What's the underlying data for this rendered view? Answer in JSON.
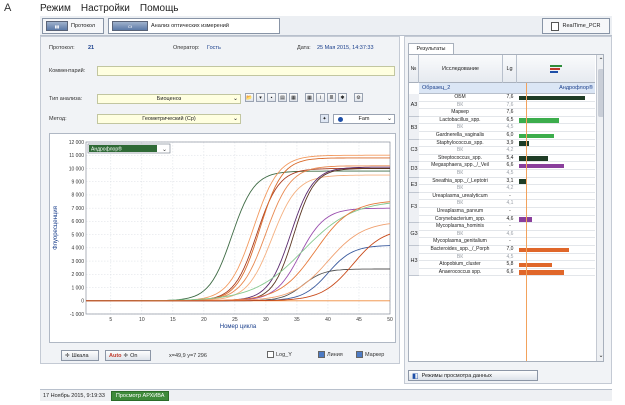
{
  "corner_label": "A",
  "menu": [
    "Режим",
    "Настройки",
    "Помощь"
  ],
  "tabs": {
    "protocol": "Протокол",
    "analysis": "Анализ оптических измерений",
    "realtime": "RealTime_PCR"
  },
  "protocol": {
    "label": "Протокол:",
    "value": "21"
  },
  "operator": {
    "label": "Оператор:",
    "value": "Гость"
  },
  "date": {
    "label": "Дата:",
    "value": "25 Мая 2015, 14:37:33"
  },
  "comment": {
    "label": "Комментарий:",
    "value": ""
  },
  "analysis_type": {
    "label": "Тип анализа:",
    "value": "Биоценоз"
  },
  "method": {
    "label": "Метод:",
    "value": "Геометрический (Cp)"
  },
  "channel": {
    "value": "Fam"
  },
  "results_tab": "Результаты",
  "table": {
    "headers": {
      "num": "№",
      "test": "Исследование",
      "lg": "Lg"
    },
    "sample": {
      "name": "Образец_2",
      "kit": "Андрофлор®"
    },
    "groups": [
      {
        "id": "A3",
        "rows": [
          {
            "name": "ОБМ",
            "lg": "7,6",
            "bar": 0.92,
            "color": "#1f3d26",
            "dim": false
          },
          {
            "name": "ВК",
            "lg": "7,6",
            "bar": 0,
            "color": "",
            "dim": true
          },
          {
            "name": "Маркер",
            "lg": "7,6",
            "bar": 0,
            "color": "",
            "dim": false
          }
        ]
      },
      {
        "id": "B3",
        "rows": [
          {
            "name": "Lactobacillus_spp.",
            "lg": "6,5",
            "bar": 0.55,
            "color": "#3cad4c",
            "dim": false
          },
          {
            "name": "ВК",
            "lg": "4,5",
            "bar": 0,
            "color": "",
            "dim": true
          },
          {
            "name": "Gardnerella_vaginalis",
            "lg": "6,0",
            "bar": 0.48,
            "color": "#3cad4c",
            "dim": false
          }
        ]
      },
      {
        "id": "C3",
        "rows": [
          {
            "name": "Staphylococcus_spp.",
            "lg": "3,9",
            "bar": 0.14,
            "color": "#1f3d26",
            "dim": false
          },
          {
            "name": "ВК",
            "lg": "4,2",
            "bar": 0,
            "color": "",
            "dim": true
          },
          {
            "name": "Streptococcus_spp.",
            "lg": "5,4",
            "bar": 0.4,
            "color": "#1f3d26",
            "dim": false
          }
        ]
      },
      {
        "id": "D3",
        "rows": [
          {
            "name": "Megasphaera_spp._/_Veil",
            "lg": "6,6",
            "bar": 0.62,
            "color": "#8a3f9c",
            "dim": false
          },
          {
            "name": "ВК",
            "lg": "4,5",
            "bar": 0,
            "color": "",
            "dim": true
          }
        ]
      },
      {
        "id": "E3",
        "rows": [
          {
            "name": "Sneathia_spp._/_Leptotri",
            "lg": "3,1",
            "bar": 0.1,
            "color": "#1f3d26",
            "dim": false
          },
          {
            "name": "ВК",
            "lg": "4,2",
            "bar": 0,
            "color": "",
            "dim": true
          }
        ]
      },
      {
        "id": "F3",
        "rows": [
          {
            "name": "Ureaplasma_urealyticum",
            "lg": "-",
            "bar": 0,
            "color": "",
            "dim": false
          },
          {
            "name": "ВК",
            "lg": "4,1",
            "bar": 0,
            "color": "",
            "dim": true
          },
          {
            "name": "Ureaplasma_parvum",
            "lg": "-",
            "bar": 0,
            "color": "",
            "dim": false
          },
          {
            "name": "Corynebacterium_spp.",
            "lg": "4,6",
            "bar": 0.18,
            "color": "#8a3f9c",
            "dim": false
          }
        ]
      },
      {
        "id": "G3",
        "rows": [
          {
            "name": "Mycoplasma_hominis",
            "lg": "-",
            "bar": 0,
            "color": "",
            "dim": false
          },
          {
            "name": "ВК",
            "lg": "4,6",
            "bar": 0,
            "color": "",
            "dim": true
          },
          {
            "name": "Mycoplasma_genitalium",
            "lg": "-",
            "bar": 0,
            "color": "",
            "dim": false
          }
        ]
      },
      {
        "id": "H3",
        "rows": [
          {
            "name": "Bacteroides_spp._/_Porph",
            "lg": "7,0",
            "bar": 0.7,
            "color": "#e0672a",
            "dim": false
          },
          {
            "name": "ВК",
            "lg": "4,5",
            "bar": 0,
            "color": "",
            "dim": true
          },
          {
            "name": "Atopobium_cluster",
            "lg": "5,8",
            "bar": 0.46,
            "color": "#e0672a",
            "dim": false
          },
          {
            "name": "Anaerococcus spp.",
            "lg": "6,6",
            "bar": 0.62,
            "color": "#e0672a",
            "dim": false
          }
        ]
      }
    ]
  },
  "results_mode_button": "Режимы просмотра данных",
  "chart_controls": {
    "scale": "Шкала",
    "auto": "Auto",
    "on": "On",
    "coords": "x=49,9 y=7 296",
    "log": "Log_Y",
    "line": "Линия",
    "marker": "Маркер"
  },
  "status": {
    "datetime": "17 Ноябрь 2015, 9:19:33",
    "viewer": "Просмотр АРХИВА"
  },
  "chart_data": {
    "type": "line",
    "title": "",
    "legend_entry": "Андрофлор®",
    "xlabel": "Номер цикла",
    "ylabel": "Флуоресценция",
    "xlim": [
      1,
      50
    ],
    "ylim": [
      -1000,
      12000
    ],
    "xticks": [
      5,
      10,
      15,
      20,
      25,
      30,
      35,
      40,
      45,
      50
    ],
    "yticks": [
      -1000,
      0,
      1000,
      2000,
      3000,
      4000,
      5000,
      6000,
      7000,
      8000,
      9000,
      10000,
      11000,
      12000
    ],
    "ytick_labels": [
      "-1 000",
      "0",
      "1 000",
      "2 000",
      "3 000",
      "4 000",
      "5 000",
      "6 000",
      "7 000",
      "8 000",
      "9 000",
      "10 000",
      "11 000",
      "12 000"
    ],
    "series": [
      {
        "color": "#3f6b45",
        "midpoint": 24.5,
        "max": 9800,
        "slope": 0.55
      },
      {
        "color": "#a83a1c",
        "midpoint": 28.5,
        "max": 10000,
        "slope": 0.55
      },
      {
        "color": "#d96b2b",
        "midpoint": 29,
        "max": 10800,
        "slope": 0.55
      },
      {
        "color": "#f39a5f",
        "midpoint": 28,
        "max": 11000,
        "slope": 0.5
      },
      {
        "color": "#e88a52",
        "midpoint": 30,
        "max": 10200,
        "slope": 0.5
      },
      {
        "color": "#f4b080",
        "midpoint": 31,
        "max": 9500,
        "slope": 0.5
      },
      {
        "color": "#5a3621",
        "midpoint": 34.5,
        "max": 10000,
        "slope": 0.6
      },
      {
        "color": "#5a2a6e",
        "midpoint": 34,
        "max": 10100,
        "slope": 0.55
      },
      {
        "color": "#9a4fae",
        "midpoint": 35.5,
        "max": 7000,
        "slope": 0.5
      },
      {
        "color": "#3b5b9e",
        "midpoint": 40,
        "max": 4200,
        "slope": 0.5
      },
      {
        "color": "#555555",
        "midpoint": 36,
        "max": 2400,
        "slope": 0.6
      },
      {
        "color": "#86c98f",
        "midpoint": 36,
        "max": 7600,
        "slope": 0.25
      },
      {
        "color": "#e67a3b",
        "midpoint": 38,
        "max": 7600,
        "slope": 0.35
      },
      {
        "color": "#f0a070",
        "midpoint": 40,
        "max": 6000,
        "slope": 0.35
      },
      {
        "color": "#c84a1a",
        "midpoint": 44,
        "max": 5500,
        "slope": 0.4
      }
    ]
  }
}
